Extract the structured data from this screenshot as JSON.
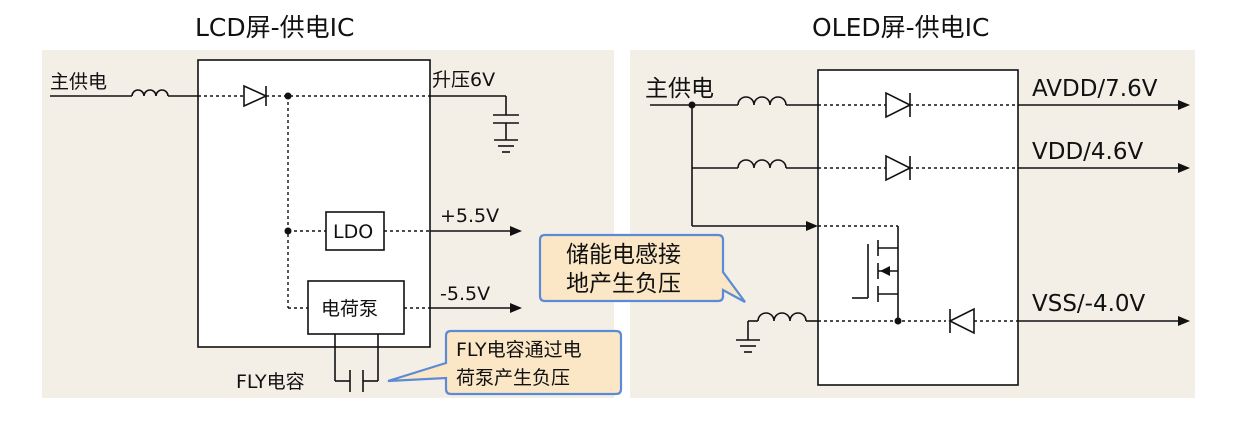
{
  "panels": {
    "lcd": {
      "title": "LCD屏-供电IC",
      "main_supply": "主供电",
      "boost": "升压6V",
      "ldo": "LDO",
      "pos_out": "+5.5V",
      "charge_pump": "电荷泵",
      "neg_out": "-5.5V",
      "fly_cap": "FLY电容",
      "callout_line1": "FLY电容通过电",
      "callout_line2": "荷泵产生负压"
    },
    "oled": {
      "title": "OLED屏-供电IC",
      "main_supply": "主供电",
      "avdd": "AVDD/7.6V",
      "vdd": "VDD/4.6V",
      "vss": "VSS/-4.0V",
      "callout_line1": "储能电感接",
      "callout_line2": "地产生负压"
    }
  },
  "colors": {
    "panel_bg": "#f3eee6",
    "callout_fill": "#fbe7c6",
    "callout_border": "#5b8ad6"
  }
}
